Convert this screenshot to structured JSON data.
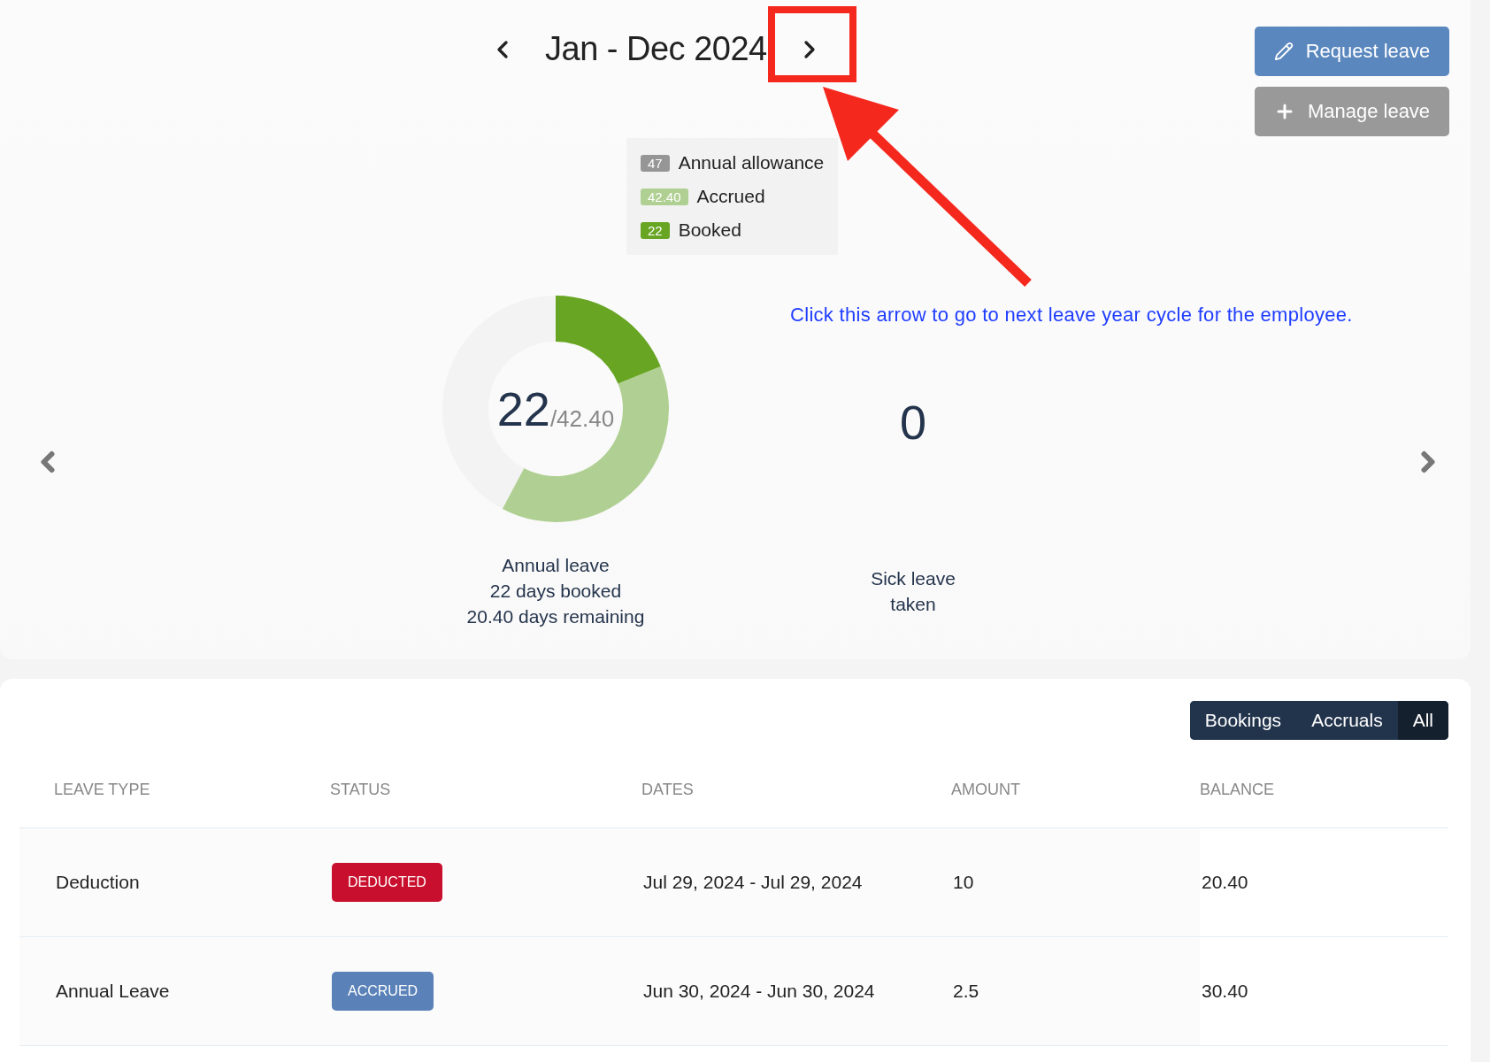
{
  "period": {
    "title": "Jan - Dec 2024"
  },
  "actions": [
    {
      "label": "Request leave",
      "kind": "primary"
    },
    {
      "label": "Manage leave",
      "kind": "secondary"
    }
  ],
  "legend": [
    {
      "value": "47",
      "label": "Annual allowance",
      "color": "#969696"
    },
    {
      "value": "42.40",
      "label": "Accrued",
      "color": "#b0d093"
    },
    {
      "value": "22",
      "label": "Booked",
      "color": "#67a523"
    }
  ],
  "annotation": {
    "text": "Click this arrow to go to next leave year cycle for the employee."
  },
  "summaries": [
    {
      "kind": "donut",
      "value": "22",
      "total": "/42.40",
      "lines": [
        "Annual leave",
        "22 days booked",
        "20.40 days remaining"
      ]
    },
    {
      "kind": "count",
      "value": "0",
      "lines": [
        "Sick leave",
        "taken"
      ]
    }
  ],
  "filters": [
    {
      "label": "Bookings",
      "selected": false
    },
    {
      "label": "Accruals",
      "selected": false
    },
    {
      "label": "All",
      "selected": true
    }
  ],
  "table": {
    "columns": [
      "LEAVE TYPE",
      "STATUS",
      "DATES",
      "AMOUNT",
      "BALANCE"
    ],
    "rows": [
      {
        "leave_type": "Deduction",
        "status": {
          "label": "DEDUCTED",
          "color": "#c8102e"
        },
        "dates": "Jul 29, 2024 - Jul 29, 2024",
        "amount": "10",
        "balance": "20.40"
      },
      {
        "leave_type": "Annual Leave",
        "status": {
          "label": "ACCRUED",
          "color": "#5a82b8"
        },
        "dates": "Jun 30, 2024 - Jun 30, 2024",
        "amount": "2.5",
        "balance": "30.40"
      }
    ]
  }
}
